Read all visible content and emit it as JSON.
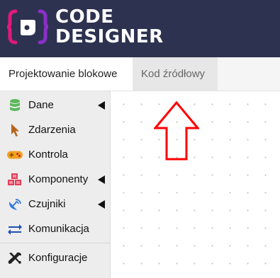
{
  "brand": {
    "line1": "CODE",
    "line2": "DESIGNER",
    "mark_colors": [
      "#e0197d",
      "#8b2fc9"
    ]
  },
  "tabs": [
    {
      "label": "Projektowanie blokowe",
      "active": true
    },
    {
      "label": "Kod źródłowy",
      "active": false
    }
  ],
  "sidebar": {
    "items": [
      {
        "label": "Dane",
        "icon": "database-icon",
        "has_submenu": true,
        "color": "#5cb85c"
      },
      {
        "label": "Zdarzenia",
        "icon": "cursor-icon",
        "has_submenu": false,
        "color": "#b5651d"
      },
      {
        "label": "Kontrola",
        "icon": "gamepad-icon",
        "has_submenu": false,
        "color": "#f0a020"
      },
      {
        "label": "Komponenty",
        "icon": "cubes-icon",
        "has_submenu": true,
        "color": "#e0405a"
      },
      {
        "label": "Czujniki",
        "icon": "satellite-dish-icon",
        "has_submenu": true,
        "color": "#3a7bd5"
      },
      {
        "label": "Komunikacja",
        "icon": "exchange-icon",
        "has_submenu": false,
        "color": "#1f4fb0"
      },
      {
        "label": "Konfiguracje",
        "icon": "tools-icon",
        "has_submenu": false,
        "color": "#222222"
      }
    ]
  },
  "workspace": {
    "annotation": "up-arrow-outline",
    "annotation_color": "#ff0000"
  }
}
